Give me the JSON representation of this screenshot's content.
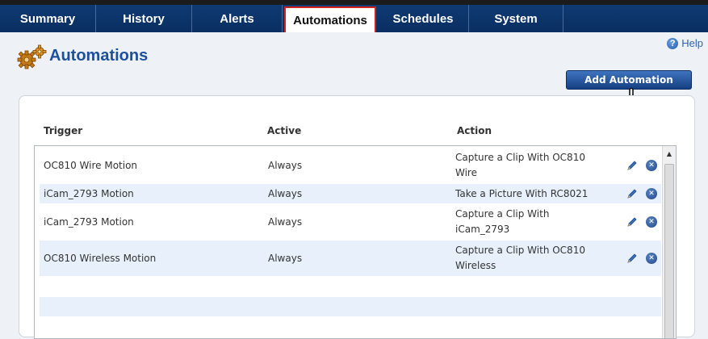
{
  "tabs": [
    {
      "label": "Summary"
    },
    {
      "label": "History"
    },
    {
      "label": "Alerts"
    },
    {
      "label": "Automations"
    },
    {
      "label": "Schedules"
    },
    {
      "label": "System"
    }
  ],
  "help": {
    "label": "Help",
    "icon": "help-icon"
  },
  "page": {
    "title": "Automations",
    "icon": "gears-icon"
  },
  "add_button": {
    "label": "Add Automation"
  },
  "table": {
    "headers": {
      "trigger": "Trigger",
      "active": "Active",
      "action": "Action"
    },
    "rows": [
      {
        "trigger": "OC810 Wire Motion",
        "active": "Always",
        "action_line1": "Capture a Clip With OC810",
        "action_line2": "Wire"
      },
      {
        "trigger": "iCam_2793 Motion",
        "active": "Always",
        "action_line1": "Take a Picture With RC8021",
        "action_line2": ""
      },
      {
        "trigger": "iCam_2793 Motion",
        "active": "Always",
        "action_line1": "Capture a Clip With",
        "action_line2": "iCam_2793"
      },
      {
        "trigger": "OC810 Wireless Motion",
        "active": "Always",
        "action_line1": "Capture a Clip With OC810",
        "action_line2": "Wireless"
      }
    ]
  },
  "colors": {
    "tabbar": "#0e3a73",
    "active_tab_border": "#d21f1f",
    "title": "#1c4f9c",
    "row_alt": "#e8f1fb"
  }
}
